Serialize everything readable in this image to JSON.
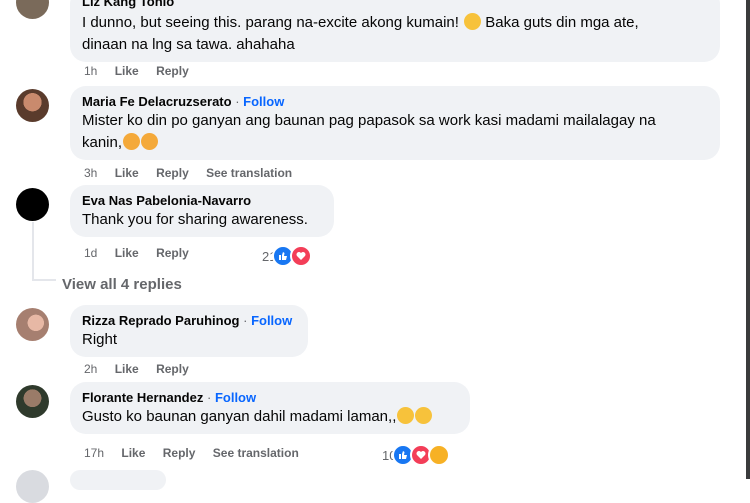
{
  "comments": [
    {
      "author": "Liz Kang Tohlo",
      "text": "I dunno, but seeing this. parang na-excite akong kumain! 😜 Baka guts din mga ate, dinaan na lng sa tawa. ahahaha",
      "line1": "I dunno, but seeing this. parang na-excite akong kumain!",
      "line1b": "Baka guts din mga ate,",
      "line2": "dinaan na lng sa tawa. ahahaha",
      "time": "1h",
      "like": "Like",
      "reply": "Reply"
    },
    {
      "author": "Maria Fe Delacruzserato",
      "dot": "·",
      "follow": "Follow",
      "line1": "Mister ko din po ganyan ang baunan pag papasok sa work kasi madami mailalagay na",
      "line2": "kanin,",
      "time": "3h",
      "like": "Like",
      "reply": "Reply",
      "translate": "See translation"
    },
    {
      "author": "Eva Nas Pabelonia-Navarro",
      "line1": "Thank you for sharing awareness.",
      "time": "1d",
      "like": "Like",
      "reply": "Reply",
      "reaction_count": "21"
    },
    {
      "author": "Rizza Reprado Paruhinog",
      "dot": "·",
      "follow": "Follow",
      "line1": "Right",
      "time": "2h",
      "like": "Like",
      "reply": "Reply"
    },
    {
      "author": "Florante Hernandez",
      "dot": "·",
      "follow": "Follow",
      "line1": "Gusto ko baunan ganyan dahil madami laman,,",
      "time": "17h",
      "like": "Like",
      "reply": "Reply",
      "translate": "See translation",
      "reaction_count": "10"
    }
  ],
  "view_replies": "View all 4 replies",
  "colors": {
    "link": "#0866ff",
    "bubble": "#f0f2f5",
    "meta": "#65676b",
    "like_blue": "#1877f2",
    "love_red": "#f33e58"
  }
}
